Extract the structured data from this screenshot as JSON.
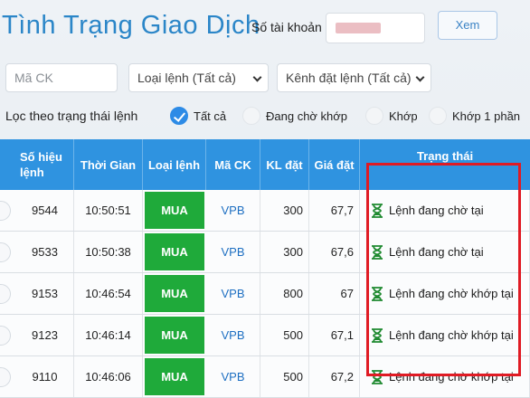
{
  "header": {
    "title": "Tình Trạng Giao Dịch",
    "account_label": "Số tài khoản",
    "view_button": "Xem"
  },
  "filters": {
    "symbol_placeholder": "Mã CK",
    "order_type_select": "Loại lệnh (Tất cả)",
    "channel_select": "Kênh đặt lệnh (Tất cả)"
  },
  "status_filter": {
    "label": "Lọc theo trạng thái lệnh",
    "options": [
      "Tất cả",
      "Đang chờ khớp",
      "Khớp",
      "Khớp 1 phần"
    ],
    "selected": "Tất cả"
  },
  "table": {
    "headers": {
      "order_no": "Số hiệu lệnh",
      "time": "Thời Gian",
      "type": "Loại lệnh",
      "symbol": "Mã CK",
      "qty": "KL đặt",
      "price": "Giá đặt",
      "status": "Trạng thái"
    },
    "rows": [
      {
        "order_no": "9544",
        "time": "10:50:51",
        "type": "MUA",
        "symbol": "VPB",
        "qty": "300",
        "price": "67,7",
        "status": "Lệnh đang chờ tại"
      },
      {
        "order_no": "9533",
        "time": "10:50:38",
        "type": "MUA",
        "symbol": "VPB",
        "qty": "300",
        "price": "67,6",
        "status": "Lệnh đang chờ tại"
      },
      {
        "order_no": "9153",
        "time": "10:46:54",
        "type": "MUA",
        "symbol": "VPB",
        "qty": "800",
        "price": "67",
        "status": "Lệnh đang chờ khớp tại"
      },
      {
        "order_no": "9123",
        "time": "10:46:14",
        "type": "MUA",
        "symbol": "VPB",
        "qty": "500",
        "price": "67,1",
        "status": "Lệnh đang chờ khớp tại"
      },
      {
        "order_no": "9110",
        "time": "10:46:06",
        "type": "MUA",
        "symbol": "VPB",
        "qty": "500",
        "price": "67,2",
        "status": "Lệnh đang chờ khớp tại"
      }
    ]
  },
  "colors": {
    "title": "#2b86c8",
    "header_bg": "#2f93e0",
    "buy_badge": "#1faa3a",
    "symbol": "#1e6fc2",
    "highlight_box": "#e01b24"
  },
  "icons": {
    "status": "hourglass-icon",
    "selected_radio": "check-icon"
  }
}
